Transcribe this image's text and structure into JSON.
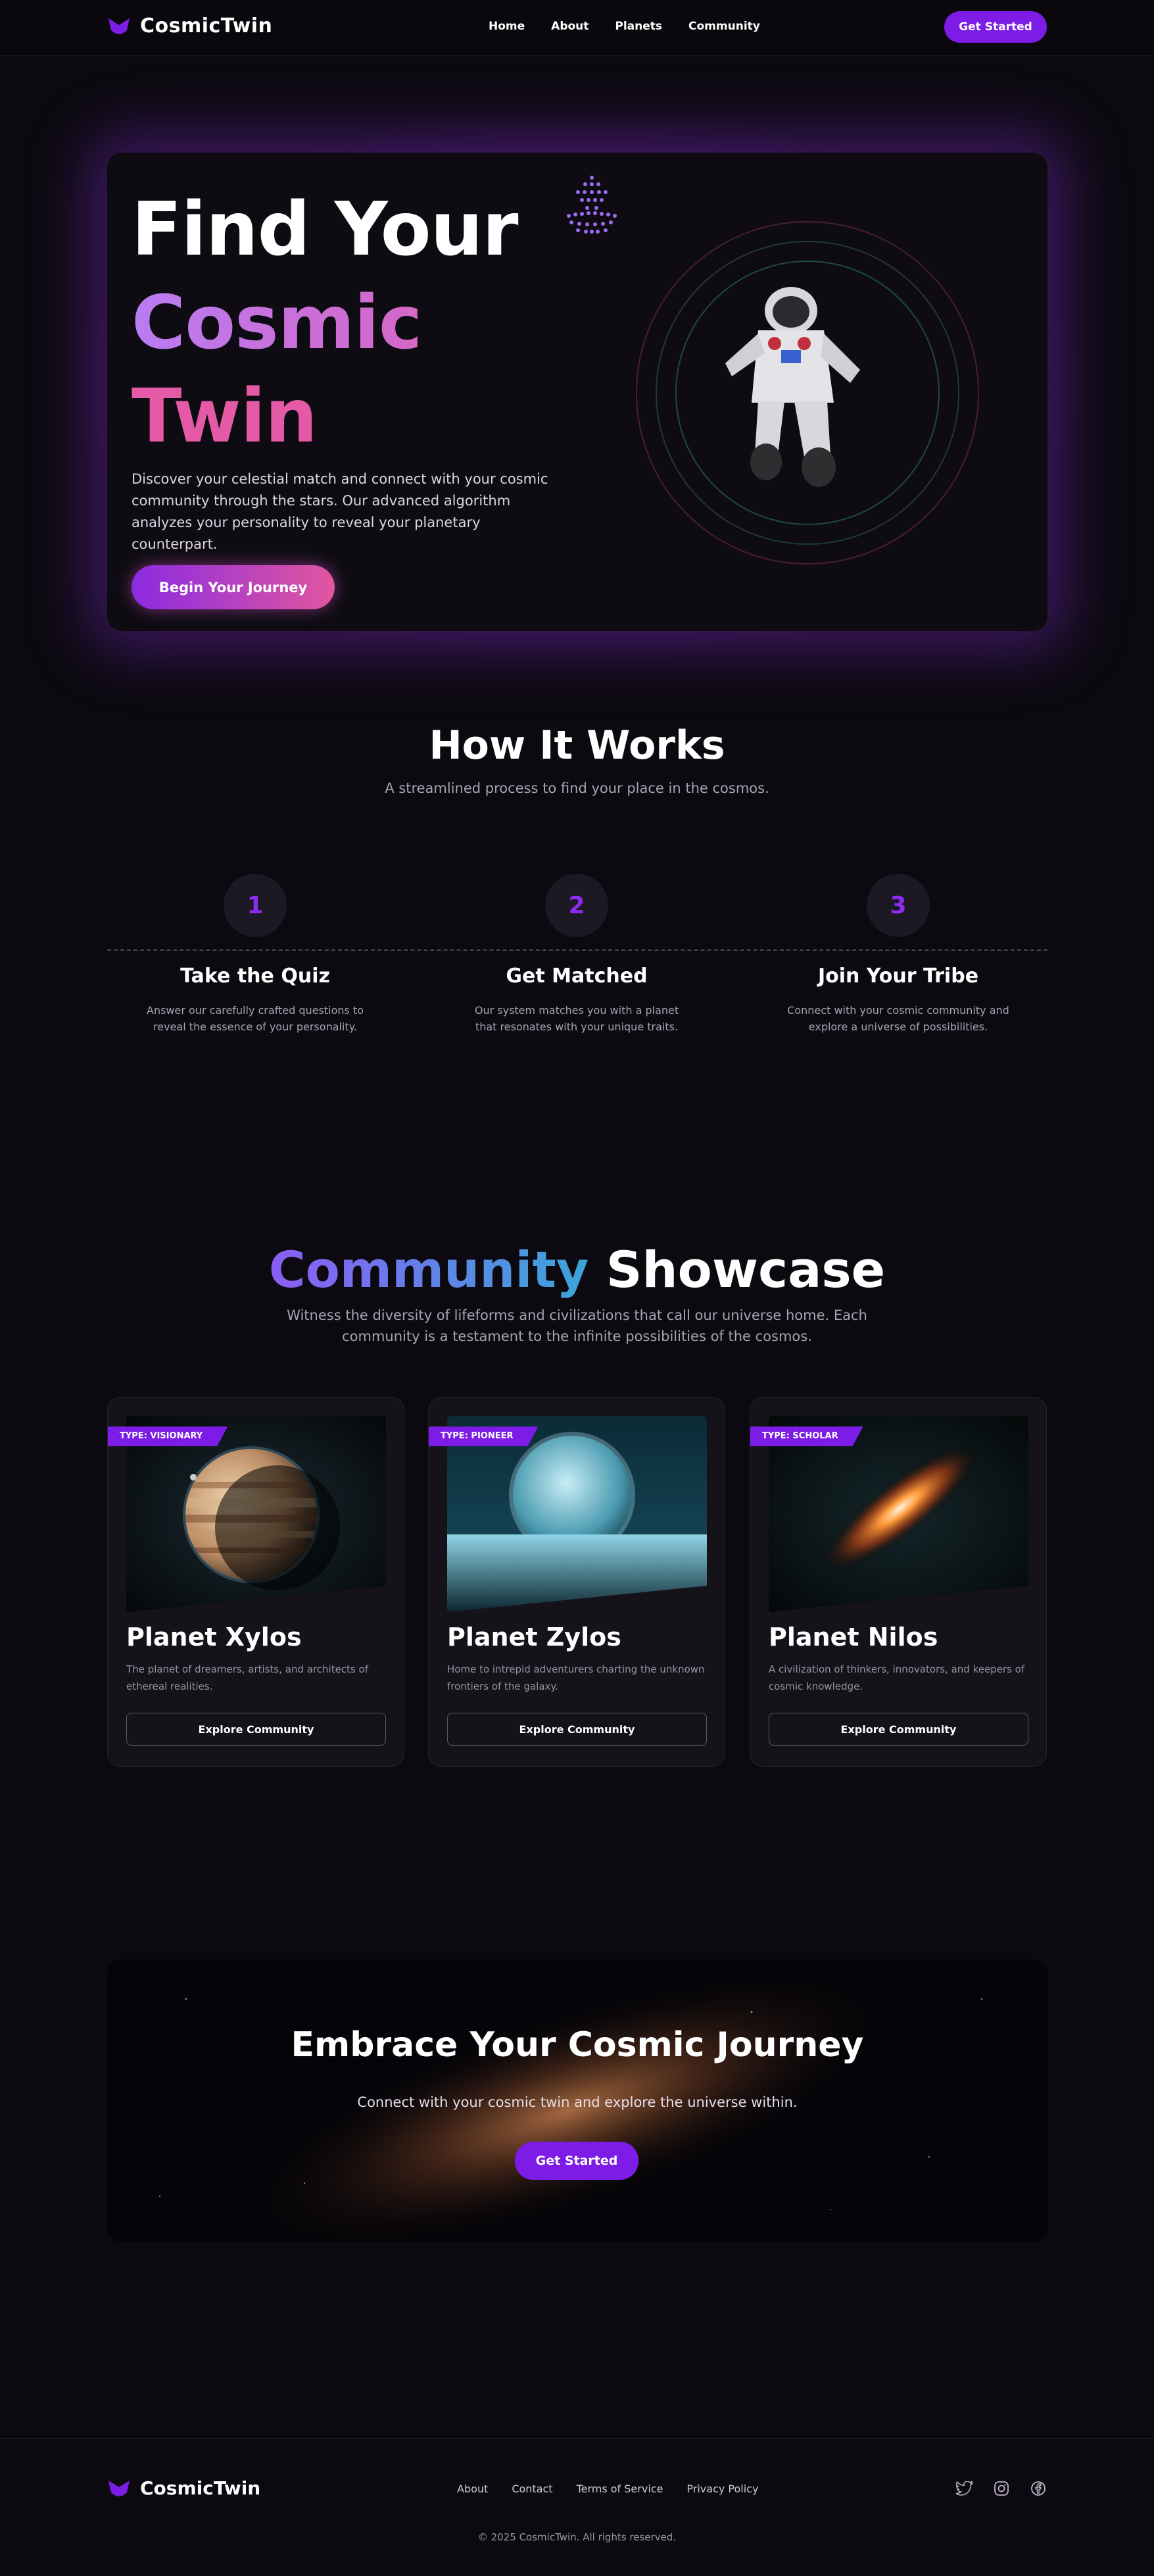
{
  "brand": {
    "name": "CosmicTwin"
  },
  "nav": {
    "links": [
      "Home",
      "About",
      "Planets",
      "Community"
    ],
    "cta": "Get Started"
  },
  "hero": {
    "title_line1": "Find Your",
    "title_line2": "Cosmic",
    "title_line3": "Twin",
    "description": "Discover your celestial match and connect with your cosmic community through the stars. Our advanced algorithm analyzes your personality to reveal your planetary counterpart.",
    "button": "Begin Your Journey"
  },
  "how_it_works": {
    "title": "How It Works",
    "subtitle": "A streamlined process to find your place in the cosmos.",
    "steps": [
      {
        "number": "1",
        "title": "Take the Quiz",
        "description": "Answer our carefully crafted questions to reveal the essence of your personality."
      },
      {
        "number": "2",
        "title": "Get Matched",
        "description": "Our system matches you with a planet that resonates with your unique traits."
      },
      {
        "number": "3",
        "title": "Join Your Tribe",
        "description": "Connect with your cosmic community and explore a universe of possibilities."
      }
    ]
  },
  "community": {
    "title_highlight": "Community",
    "title_rest": "Showcase",
    "subtitle": "Witness the diversity of lifeforms and civilizations that call our universe home. Each community is a testament to the infinite possibilities of the cosmos.",
    "cards": [
      {
        "tag": "TYPE: VISIONARY",
        "name": "Planet Xylos",
        "description": "The planet of dreamers, artists, and architects of ethereal realities.",
        "button": "Explore Community"
      },
      {
        "tag": "TYPE: PIONEER",
        "name": "Planet Zylos",
        "description": "Home to intrepid adventurers charting the unknown frontiers of the galaxy.",
        "button": "Explore Community"
      },
      {
        "tag": "TYPE: SCHOLAR",
        "name": "Planet Nilos",
        "description": "A civilization of thinkers, innovators, and keepers of cosmic knowledge.",
        "button": "Explore Community"
      }
    ]
  },
  "cta": {
    "title": "Embrace Your Cosmic Journey",
    "subtitle": "Connect with your cosmic twin and explore the universe within.",
    "button": "Get Started"
  },
  "footer": {
    "links": [
      "About",
      "Contact",
      "Terms of Service",
      "Privacy Policy"
    ],
    "social": [
      "twitter-icon",
      "instagram-icon",
      "facebook-icon"
    ],
    "copyright": "© 2025 CosmicTwin. All rights reserved."
  },
  "colors": {
    "accent": "#7c1ce6",
    "pink": "#e2569f",
    "background": "#0c0a10"
  }
}
